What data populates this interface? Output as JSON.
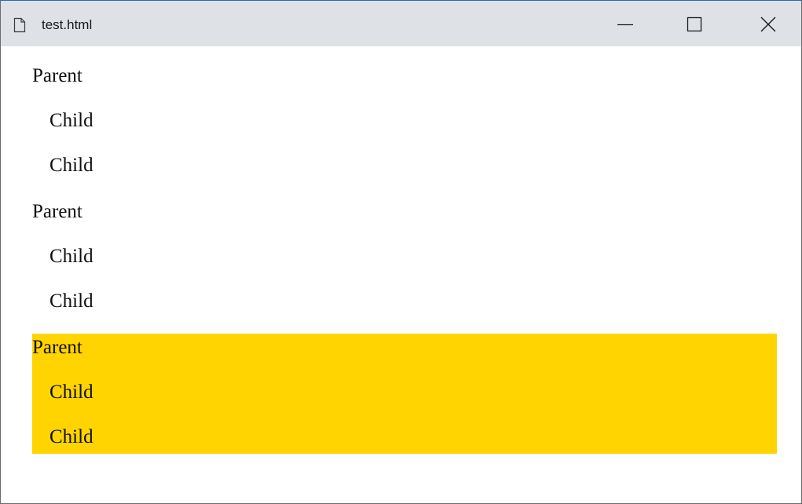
{
  "window": {
    "title": "test.html",
    "controls": {
      "minimize_icon": "minimize-icon",
      "maximize_icon": "maximize-icon",
      "close_icon": "close-icon"
    }
  },
  "page": {
    "highlight_color": "#ffd400",
    "groups": [
      {
        "parent": "Parent",
        "children": [
          "Child",
          "Child"
        ],
        "highlighted": false
      },
      {
        "parent": "Parent",
        "children": [
          "Child",
          "Child"
        ],
        "highlighted": false
      },
      {
        "parent": "Parent",
        "children": [
          "Child",
          "Child"
        ],
        "highlighted": true
      }
    ]
  }
}
